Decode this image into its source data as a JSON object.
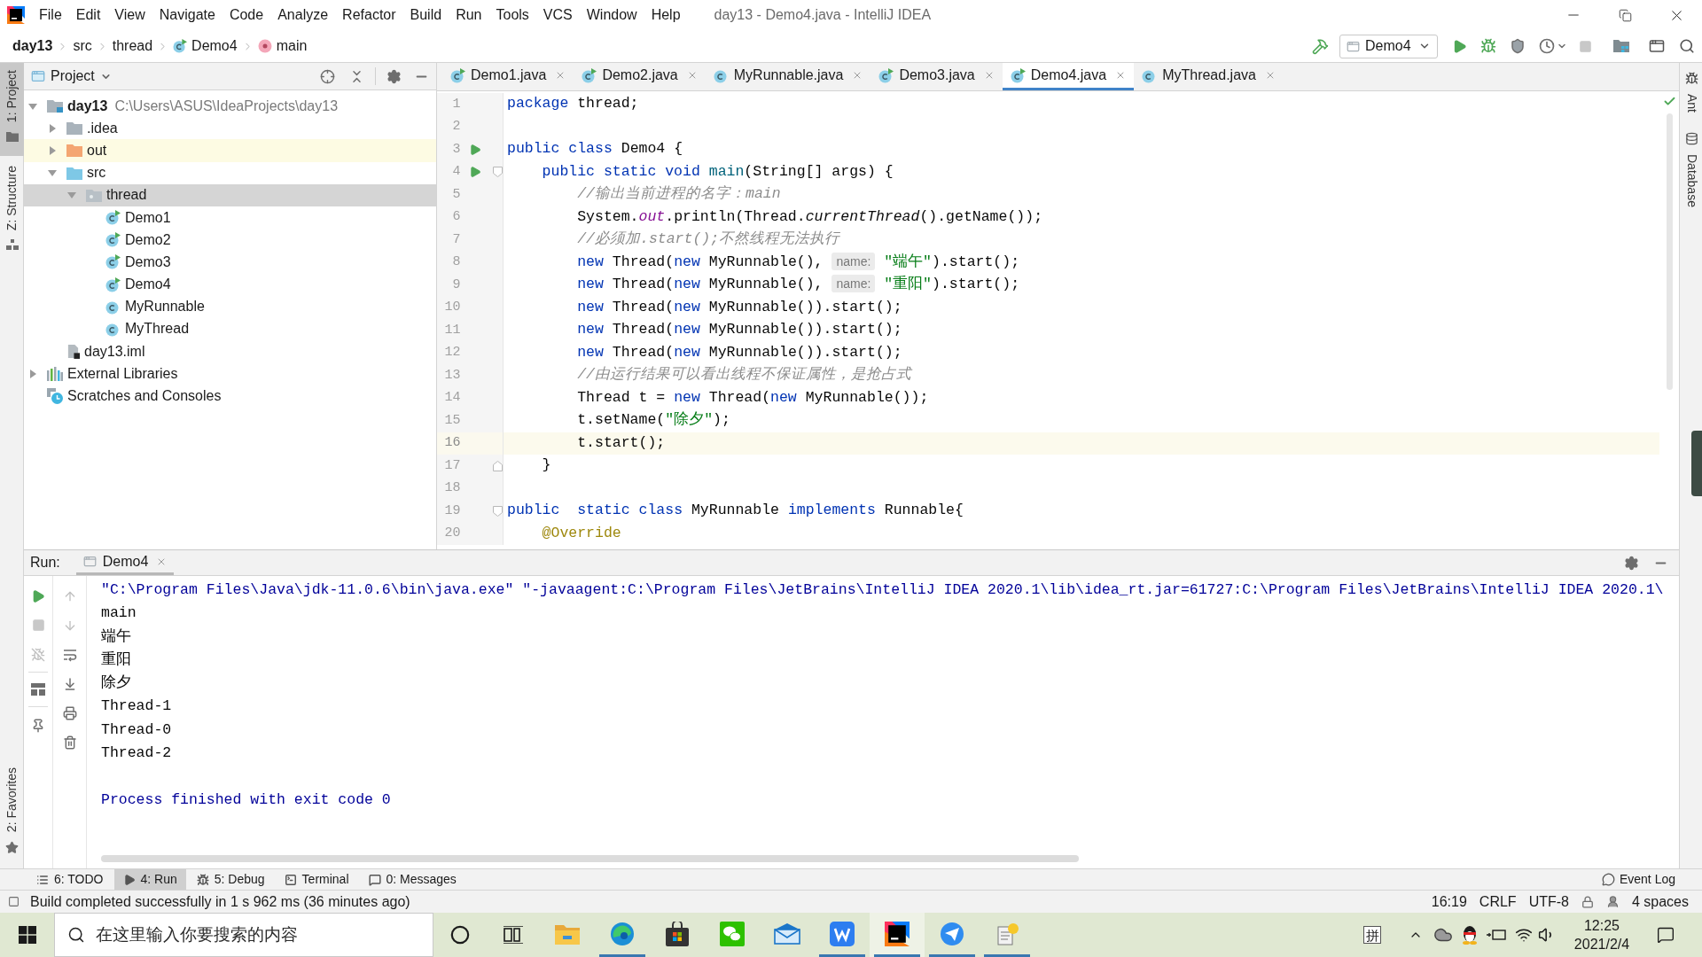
{
  "window": {
    "title": "day13 - Demo4.java - IntelliJ IDEA"
  },
  "menu": [
    "File",
    "Edit",
    "View",
    "Navigate",
    "Code",
    "Analyze",
    "Refactor",
    "Build",
    "Run",
    "Tools",
    "VCS",
    "Window",
    "Help"
  ],
  "breadcrumbs": [
    {
      "label": "day13",
      "kind": "project"
    },
    {
      "label": "src",
      "kind": "folder"
    },
    {
      "label": "thread",
      "kind": "folder"
    },
    {
      "label": "Demo4",
      "kind": "class"
    },
    {
      "label": "main",
      "kind": "method"
    }
  ],
  "run_config": {
    "label": "Demo4"
  },
  "tool_strip_left": [
    {
      "label": "1: Project",
      "kind": "project",
      "selected": true
    },
    {
      "label": "Z: Structure",
      "kind": "structure",
      "selected": false
    }
  ],
  "tool_strip_left_bottom": [
    {
      "label": "2: Favorites",
      "kind": "favorites",
      "selected": false
    }
  ],
  "tool_strip_right": [
    {
      "label": "Ant",
      "kind": "ant"
    },
    {
      "label": "Database",
      "kind": "database"
    }
  ],
  "project_panel": {
    "title": "Project",
    "tree": [
      {
        "label": "day13",
        "detail": "C:\\Users\\ASUS\\IdeaProjects\\day13",
        "kind": "module",
        "expanded": true,
        "selected": false,
        "highlighted": false,
        "children": [
          {
            "label": ".idea",
            "kind": "folder",
            "expanded": false,
            "selected": false,
            "highlighted": false
          },
          {
            "label": "out",
            "kind": "excluded",
            "expanded": false,
            "selected": false,
            "highlighted": true
          },
          {
            "label": "src",
            "kind": "source",
            "expanded": true,
            "selected": false,
            "highlighted": false,
            "children": [
              {
                "label": "thread",
                "kind": "package",
                "expanded": true,
                "selected": true,
                "highlighted": false,
                "children": [
                  {
                    "label": "Demo1",
                    "kind": "runnable_class",
                    "selected": false,
                    "highlighted": false
                  },
                  {
                    "label": "Demo2",
                    "kind": "runnable_class",
                    "selected": false,
                    "highlighted": false
                  },
                  {
                    "label": "Demo3",
                    "kind": "runnable_class",
                    "selected": false,
                    "highlighted": false
                  },
                  {
                    "label": "Demo4",
                    "kind": "runnable_class",
                    "selected": false,
                    "highlighted": false
                  },
                  {
                    "label": "MyRunnable",
                    "kind": "class",
                    "selected": false,
                    "highlighted": false
                  },
                  {
                    "label": "MyThread",
                    "kind": "class",
                    "selected": false,
                    "highlighted": false
                  }
                ]
              }
            ]
          },
          {
            "label": "day13.iml",
            "kind": "iml",
            "selected": false,
            "highlighted": false
          }
        ]
      },
      {
        "label": "External Libraries",
        "kind": "libraries",
        "expanded": false,
        "selected": false,
        "highlighted": false
      },
      {
        "label": "Scratches and Consoles",
        "kind": "scratches",
        "selected": false,
        "highlighted": false
      }
    ]
  },
  "editor": {
    "tabs": [
      {
        "label": "Demo1.java",
        "kind": "runnable_class",
        "selected": false
      },
      {
        "label": "Demo2.java",
        "kind": "runnable_class",
        "selected": false
      },
      {
        "label": "MyRunnable.java",
        "kind": "class",
        "selected": false
      },
      {
        "label": "Demo3.java",
        "kind": "runnable_class",
        "selected": false
      },
      {
        "label": "Demo4.java",
        "kind": "runnable_class",
        "selected": true
      },
      {
        "label": "MyThread.java",
        "kind": "class",
        "selected": false
      }
    ],
    "lines": [
      {
        "number": "1",
        "current": false,
        "tokens": [
          {
            "kind": "keyword",
            "text": "package"
          },
          {
            "kind": "plain",
            "text": " thread;"
          }
        ]
      },
      {
        "number": "2",
        "current": false
      },
      {
        "number": "3",
        "current": false,
        "run": true,
        "tokens": [
          {
            "kind": "keyword",
            "text": "public class"
          },
          {
            "kind": "plain",
            "text": " Demo4 {"
          }
        ]
      },
      {
        "number": "4",
        "current": false,
        "run": true,
        "fold_open": true,
        "tokens": [
          {
            "kind": "keyword",
            "text": "    public static void "
          },
          {
            "kind": "method_decl",
            "text": "main"
          },
          {
            "kind": "plain",
            "text": "(String[] args) {"
          }
        ]
      },
      {
        "number": "5",
        "current": false,
        "tokens": [
          {
            "kind": "comment",
            "text": "        //输出当前进程的名字：main"
          }
        ]
      },
      {
        "number": "6",
        "current": false,
        "tokens": [
          {
            "kind": "plain",
            "text": "        System."
          },
          {
            "kind": "field",
            "text": "out"
          },
          {
            "kind": "plain",
            "text": ".println(Thread."
          },
          {
            "kind": "static_call",
            "text": "currentThread"
          },
          {
            "kind": "plain",
            "text": "().getName());"
          }
        ]
      },
      {
        "number": "7",
        "current": false,
        "tokens": [
          {
            "kind": "comment",
            "text": "        //必须加.start();不然线程无法执行"
          }
        ]
      },
      {
        "number": "8",
        "current": false,
        "tokens": [
          {
            "kind": "keyword",
            "text": "        new"
          },
          {
            "kind": "plain",
            "text": " Thread("
          },
          {
            "kind": "keyword",
            "text": "new"
          },
          {
            "kind": "plain",
            "text": " MyRunnable(), "
          },
          {
            "kind": "hint",
            "text": "name:"
          },
          {
            "kind": "string",
            "text": "\"端午\""
          },
          {
            "kind": "plain",
            "text": ").start();"
          }
        ]
      },
      {
        "number": "9",
        "current": false,
        "tokens": [
          {
            "kind": "keyword",
            "text": "        new"
          },
          {
            "kind": "plain",
            "text": " Thread("
          },
          {
            "kind": "keyword",
            "text": "new"
          },
          {
            "kind": "plain",
            "text": " MyRunnable(), "
          },
          {
            "kind": "hint",
            "text": "name:"
          },
          {
            "kind": "string",
            "text": "\"重阳\""
          },
          {
            "kind": "plain",
            "text": ").start();"
          }
        ]
      },
      {
        "number": "10",
        "current": false,
        "tokens": [
          {
            "kind": "keyword",
            "text": "        new"
          },
          {
            "kind": "plain",
            "text": " Thread("
          },
          {
            "kind": "keyword",
            "text": "new"
          },
          {
            "kind": "plain",
            "text": " MyRunnable()).start();"
          }
        ]
      },
      {
        "number": "11",
        "current": false,
        "tokens": [
          {
            "kind": "keyword",
            "text": "        new"
          },
          {
            "kind": "plain",
            "text": " Thread("
          },
          {
            "kind": "keyword",
            "text": "new"
          },
          {
            "kind": "plain",
            "text": " MyRunnable()).start();"
          }
        ]
      },
      {
        "number": "12",
        "current": false,
        "tokens": [
          {
            "kind": "keyword",
            "text": "        new"
          },
          {
            "kind": "plain",
            "text": " Thread("
          },
          {
            "kind": "keyword",
            "text": "new"
          },
          {
            "kind": "plain",
            "text": " MyRunnable()).start();"
          }
        ]
      },
      {
        "number": "13",
        "current": false,
        "tokens": [
          {
            "kind": "comment",
            "text": "        //由运行结果可以看出线程不保证属性，是抢占式"
          }
        ]
      },
      {
        "number": "14",
        "current": false,
        "tokens": [
          {
            "kind": "plain",
            "text": "        Thread t = "
          },
          {
            "kind": "keyword",
            "text": "new"
          },
          {
            "kind": "plain",
            "text": " Thread("
          },
          {
            "kind": "keyword",
            "text": "new"
          },
          {
            "kind": "plain",
            "text": " MyRunnable());"
          }
        ]
      },
      {
        "number": "15",
        "current": false,
        "tokens": [
          {
            "kind": "plain",
            "text": "        t.setName("
          },
          {
            "kind": "string",
            "text": "\"除夕\""
          },
          {
            "kind": "plain",
            "text": ");"
          }
        ]
      },
      {
        "number": "16",
        "current": true,
        "tokens": [
          {
            "kind": "plain",
            "text": "        t.start();"
          }
        ]
      },
      {
        "number": "17",
        "current": false,
        "fold_close": true,
        "tokens": [
          {
            "kind": "plain",
            "text": "    }"
          }
        ]
      },
      {
        "number": "18",
        "current": false
      },
      {
        "number": "19",
        "current": false,
        "fold_open": true,
        "tokens": [
          {
            "kind": "keyword",
            "text": "public  static class"
          },
          {
            "kind": "plain",
            "text": " MyRunnable "
          },
          {
            "kind": "keyword",
            "text": "implements"
          },
          {
            "kind": "plain",
            "text": " Runnable{"
          }
        ]
      },
      {
        "number": "20",
        "current": false,
        "tokens": [
          {
            "kind": "annotation",
            "text": "    @Override"
          }
        ]
      }
    ]
  },
  "run_panel": {
    "label": "Run:",
    "tabs": [
      {
        "label": "Demo4",
        "selected": true
      }
    ],
    "console": [
      {
        "kind": "system",
        "text": "\"C:\\Program Files\\Java\\jdk-11.0.6\\bin\\java.exe\" \"-javaagent:C:\\Program Files\\JetBrains\\IntelliJ IDEA 2020.1\\lib\\idea_rt.jar=61727:C:\\Program Files\\JetBrains\\IntelliJ IDEA 2020.1\\"
      },
      {
        "kind": "output",
        "text": "main"
      },
      {
        "kind": "output",
        "text": "端午"
      },
      {
        "kind": "output",
        "text": "重阳"
      },
      {
        "kind": "output",
        "text": "除夕"
      },
      {
        "kind": "output",
        "text": "Thread-1"
      },
      {
        "kind": "output",
        "text": "Thread-0"
      },
      {
        "kind": "output",
        "text": "Thread-2"
      },
      {
        "kind": "system",
        "text": "Process finished with exit code 0",
        "blank_before": true
      }
    ]
  },
  "tool_window_bar": {
    "items": [
      {
        "label": "6: TODO",
        "kind": "todo",
        "selected": false
      },
      {
        "label": "4: Run",
        "kind": "run",
        "selected": true
      },
      {
        "label": "5: Debug",
        "kind": "debug",
        "selected": false
      },
      {
        "label": "Terminal",
        "kind": "terminal",
        "selected": false
      },
      {
        "label": "0: Messages",
        "kind": "messages",
        "selected": false
      }
    ],
    "event_log": "Event Log"
  },
  "status_bar": {
    "message": "Build completed successfully in 1 s 962 ms (36 minutes ago)",
    "position": "16:19",
    "line_separator": "CRLF",
    "encoding": "UTF-8",
    "indent": "4 spaces"
  },
  "taskbar": {
    "search_placeholder": "在这里输入你要搜索的内容",
    "apps": [
      {
        "kind": "explorer",
        "running": false,
        "selected": false
      },
      {
        "kind": "edge",
        "running": true,
        "selected": false
      },
      {
        "kind": "store",
        "running": false,
        "selected": false
      },
      {
        "kind": "wechat",
        "running": false,
        "selected": false
      },
      {
        "kind": "mail",
        "running": false,
        "selected": false
      },
      {
        "kind": "wps",
        "running": true,
        "selected": false
      },
      {
        "kind": "intellij",
        "running": true,
        "selected": true
      },
      {
        "kind": "bird",
        "running": true,
        "selected": false
      },
      {
        "kind": "notes",
        "running": true,
        "selected": false
      }
    ],
    "ime": "拼",
    "time": "12:25",
    "date": "2021/2/4"
  }
}
